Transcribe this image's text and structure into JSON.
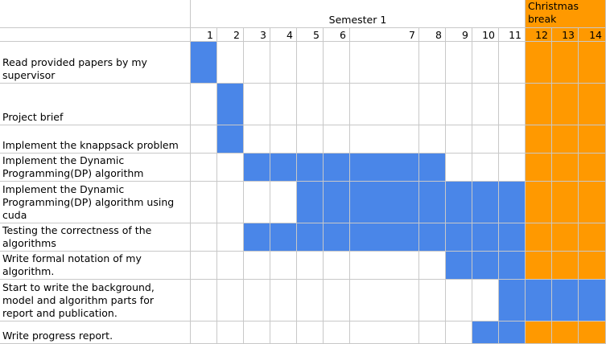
{
  "colors": {
    "task": "#4a86e8",
    "break": "#ff9900",
    "grid": "#c8c8c8"
  },
  "chart_data": {
    "type": "gantt",
    "header": {
      "semester": "Semester 1",
      "break": "Christmas break"
    },
    "weeks": [
      "1",
      "2",
      "3",
      "4",
      "5",
      "6",
      "7",
      "8",
      "9",
      "10",
      "11",
      "12",
      "13",
      "14"
    ],
    "break_weeks": [
      12,
      13,
      14
    ],
    "tasks": [
      {
        "label": "Read provided papers by my supervisor",
        "start": 1,
        "end": 1
      },
      {
        "label": "Project brief",
        "start": 2,
        "end": 2
      },
      {
        "label": "Implement the knappsack problem",
        "start": 2,
        "end": 2
      },
      {
        "label": "Implement the Dynamic Programming(DP) algorithm",
        "start": 3,
        "end": 8
      },
      {
        "label": "Implement the Dynamic Programming(DP) algorithm using cuda",
        "start": 5,
        "end": 11
      },
      {
        "label": "Testing the correctness of the algorithms",
        "start": 3,
        "end": 11
      },
      {
        "label": "Write formal notation of my algorithm.",
        "start": 9,
        "end": 11
      },
      {
        "label": "Start to write the background, model and algorithm parts for report and publication.",
        "start": 11,
        "end": 14
      },
      {
        "label": "Write progress report.",
        "start": 10,
        "end": 11
      }
    ]
  }
}
